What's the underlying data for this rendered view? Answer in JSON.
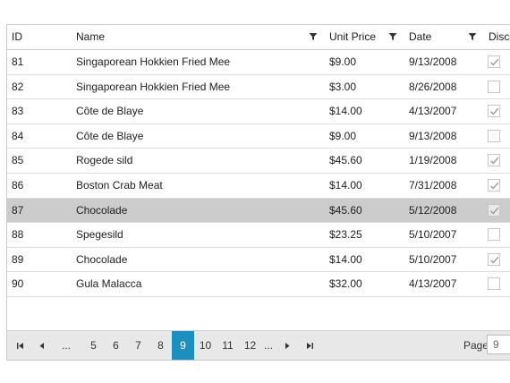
{
  "grid": {
    "columns": {
      "id": "ID",
      "name": "Name",
      "unit_price": "Unit Price",
      "date": "Date",
      "discontinued": "Disco"
    },
    "rows": [
      {
        "id": "81",
        "name": "Singaporean Hokkien Fried Mee",
        "price": "$9.00",
        "date": "9/13/2008",
        "discontinued": true,
        "selected": false
      },
      {
        "id": "82",
        "name": "Singaporean Hokkien Fried Mee",
        "price": "$3.00",
        "date": "8/26/2008",
        "discontinued": false,
        "selected": false
      },
      {
        "id": "83",
        "name": "Côte de Blaye",
        "price": "$14.00",
        "date": "4/13/2007",
        "discontinued": true,
        "selected": false
      },
      {
        "id": "84",
        "name": "Côte de Blaye",
        "price": "$9.00",
        "date": "9/13/2008",
        "discontinued": false,
        "selected": false
      },
      {
        "id": "85",
        "name": "Rogede sild",
        "price": "$45.60",
        "date": "1/19/2008",
        "discontinued": true,
        "selected": false
      },
      {
        "id": "86",
        "name": "Boston Crab Meat",
        "price": "$14.00",
        "date": "7/31/2008",
        "discontinued": true,
        "selected": false
      },
      {
        "id": "87",
        "name": "Chocolade",
        "price": "$45.60",
        "date": "5/12/2008",
        "discontinued": true,
        "selected": true
      },
      {
        "id": "88",
        "name": "Spegesild",
        "price": "$23.25",
        "date": "5/10/2007",
        "discontinued": false,
        "selected": false
      },
      {
        "id": "89",
        "name": "Chocolade",
        "price": "$14.00",
        "date": "5/10/2007",
        "discontinued": true,
        "selected": false
      },
      {
        "id": "90",
        "name": "Gula Malacca",
        "price": "$32.00",
        "date": "4/13/2007",
        "discontinued": false,
        "selected": false
      }
    ]
  },
  "pager": {
    "first_icon": "first-page-icon",
    "prev_icon": "previous-page-icon",
    "next_icon": "next-page-icon",
    "last_icon": "last-page-icon",
    "ellipsis": "...",
    "pages": [
      "5",
      "6",
      "7",
      "8",
      "9",
      "10",
      "11",
      "12"
    ],
    "current_page": "9",
    "page_label": "Page",
    "page_input_value": "9"
  },
  "colors": {
    "accent": "#1a8fc0",
    "selected_row": "#cccccc",
    "pager_bg": "#e8e8e8"
  }
}
